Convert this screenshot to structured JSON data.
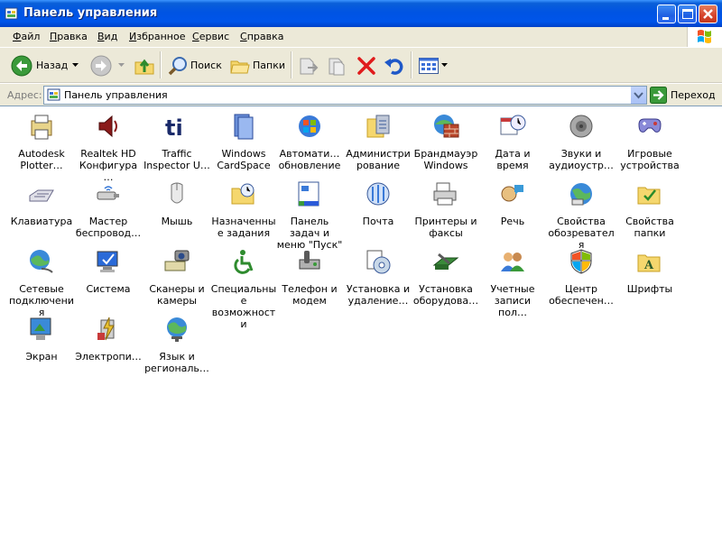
{
  "window": {
    "title": "Панель управления"
  },
  "menu": [
    "Файл",
    "Правка",
    "Вид",
    "Избранное",
    "Сервис",
    "Справка"
  ],
  "toolbar": {
    "back": "Назад",
    "search": "Поиск",
    "folders": "Папки"
  },
  "address": {
    "label": "Адрес:",
    "value": "Панель управления",
    "go": "Переход"
  },
  "items": [
    {
      "label": "Autodesk Plotter…",
      "icon": "autodesk-plotter-icon"
    },
    {
      "label": "Realtek HD Конфигура…",
      "icon": "realtek-speaker-icon"
    },
    {
      "label": "Traffic Inspector U…",
      "icon": "traffic-inspector-icon"
    },
    {
      "label": "Windows CardSpace",
      "icon": "cardspace-icon"
    },
    {
      "label": "Автомати… обновление",
      "icon": "windows-update-icon"
    },
    {
      "label": "Администрирование",
      "icon": "admin-tools-icon"
    },
    {
      "label": "Брандмауэр Windows",
      "icon": "firewall-icon"
    },
    {
      "label": "Дата и время",
      "icon": "date-time-icon"
    },
    {
      "label": "Звуки и аудиоустр…",
      "icon": "sounds-icon"
    },
    {
      "label": "Игровые устройства",
      "icon": "game-controller-icon"
    },
    {
      "label": "Клавиатура",
      "icon": "keyboard-icon"
    },
    {
      "label": "Мастер беспровод…",
      "icon": "wireless-wizard-icon"
    },
    {
      "label": "Мышь",
      "icon": "mouse-icon"
    },
    {
      "label": "Назначенные задания",
      "icon": "scheduled-tasks-icon"
    },
    {
      "label": "Панель задач и меню \"Пуск\"",
      "icon": "taskbar-icon"
    },
    {
      "label": "Почта",
      "icon": "mail-icon"
    },
    {
      "label": "Принтеры и факсы",
      "icon": "printer-icon"
    },
    {
      "label": "Речь",
      "icon": "speech-icon"
    },
    {
      "label": "Свойства обозревателя",
      "icon": "internet-options-icon"
    },
    {
      "label": "Свойства папки",
      "icon": "folder-options-icon"
    },
    {
      "label": "Сетевые подключения",
      "icon": "network-connections-icon"
    },
    {
      "label": "Система",
      "icon": "system-icon"
    },
    {
      "label": "Сканеры и камеры",
      "icon": "scanner-camera-icon"
    },
    {
      "label": "Специальные возможности",
      "icon": "accessibility-icon"
    },
    {
      "label": "Телефон и модем",
      "icon": "phone-modem-icon"
    },
    {
      "label": "Установка и удаление…",
      "icon": "add-remove-programs-icon"
    },
    {
      "label": "Установка оборудова…",
      "icon": "add-hardware-icon"
    },
    {
      "label": "Учетные записи пол…",
      "icon": "user-accounts-icon"
    },
    {
      "label": "Центр обеспечен…",
      "icon": "security-center-icon"
    },
    {
      "label": "Шрифты",
      "icon": "fonts-icon"
    },
    {
      "label": "Экран",
      "icon": "display-icon"
    },
    {
      "label": "Электропи…",
      "icon": "power-options-icon"
    },
    {
      "label": "Язык и региональ…",
      "icon": "regional-options-icon"
    }
  ]
}
